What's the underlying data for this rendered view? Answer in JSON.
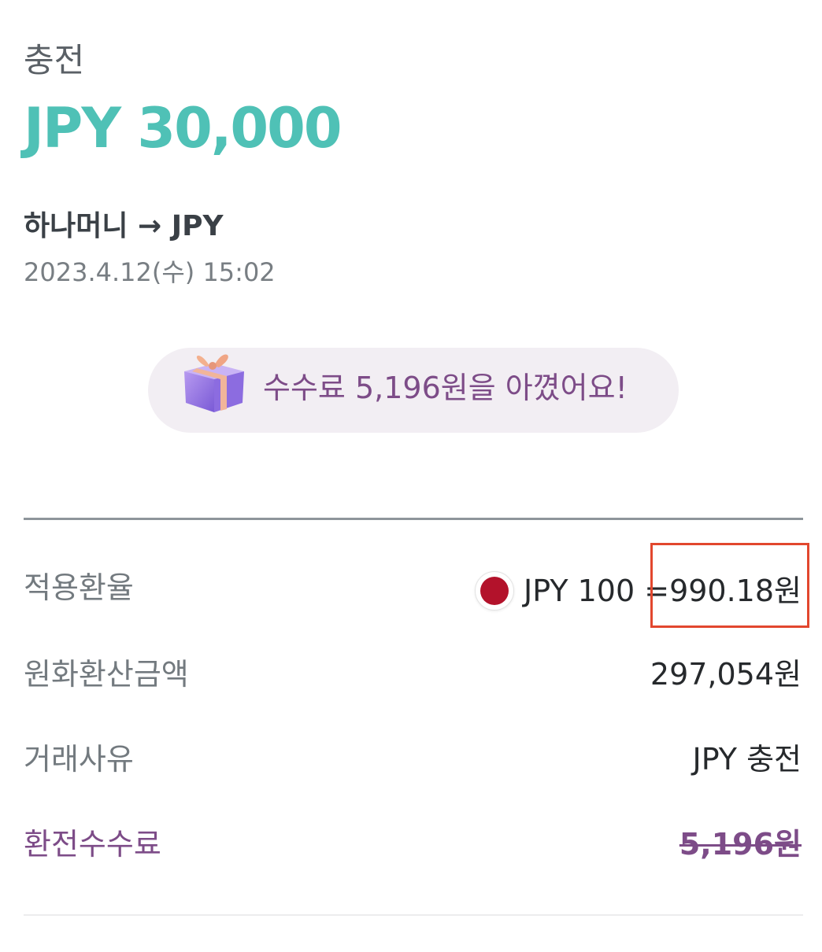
{
  "header": {
    "title": "충전",
    "amount": "JPY 30,000",
    "route": "하나머니 → JPY",
    "datetime": "2023.4.12(수) 15:02"
  },
  "savings": {
    "text": "수수료 5,196원을 아꼈어요!",
    "icon": "gift-icon"
  },
  "details": {
    "rate": {
      "label": "적용환율",
      "prefix": "JPY 100 =",
      "value": "990.18원",
      "flag_icon": "japan-flag-icon"
    },
    "krw_amount": {
      "label": "원화환산금액",
      "value": "297,054원"
    },
    "reason": {
      "label": "거래사유",
      "value": "JPY 충전"
    },
    "fee": {
      "label": "환전수수료",
      "value": "5,196원"
    }
  },
  "colors": {
    "accent": "#4fc1b6",
    "purple": "#7d4c88",
    "highlight": "#e2472e",
    "flag_red": "#b3122b"
  }
}
